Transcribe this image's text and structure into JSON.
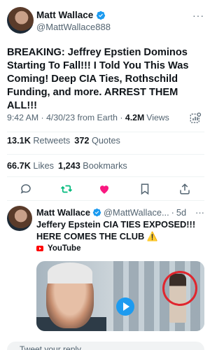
{
  "tweet": {
    "author_name": "Matt Wallace",
    "author_handle": "@MattWallace888",
    "more_glyph": "···",
    "text": "BREAKING: Jeffrey Epstien Dominos Starting To Fall!!! I Told You This Was Coming! Deep CIA Ties, Rothschild Funding, and more. ARREST THEM ALL!!!",
    "time": "9:42 AM",
    "date": "4/30/23",
    "source": "from Earth",
    "views_count": "4.2M",
    "views_label": "Views",
    "sep": "·"
  },
  "stats": {
    "retweets_count": "13.1K",
    "retweets_label": "Retweets",
    "quotes_count": "372",
    "quotes_label": "Quotes",
    "likes_count": "66.7K",
    "likes_label": "Likes",
    "bookmarks_count": "1,243",
    "bookmarks_label": "Bookmarks"
  },
  "actions": [
    {
      "icon": "reply-icon"
    },
    {
      "icon": "retweet-icon",
      "color": "#00ba7c"
    },
    {
      "icon": "like-icon",
      "color": "#f91880"
    },
    {
      "icon": "bookmark-icon"
    },
    {
      "icon": "share-icon"
    }
  ],
  "quote": {
    "author_name": "Matt Wallace",
    "author_handle": "@MattWallace...",
    "sep": "·",
    "time": "5d",
    "more_glyph": "···",
    "text": "Jeffery Epstein CIA TIES EXPOSED!!! HERE COMES THE CLUB ⚠️",
    "source_label": "YouTube"
  },
  "bottom": {
    "placeholder": "Tweet your reply"
  },
  "colors": {
    "verified": "#1d9bf0",
    "retweet": "#00ba7c",
    "like": "#f91880",
    "secondary_text": "#536471"
  }
}
